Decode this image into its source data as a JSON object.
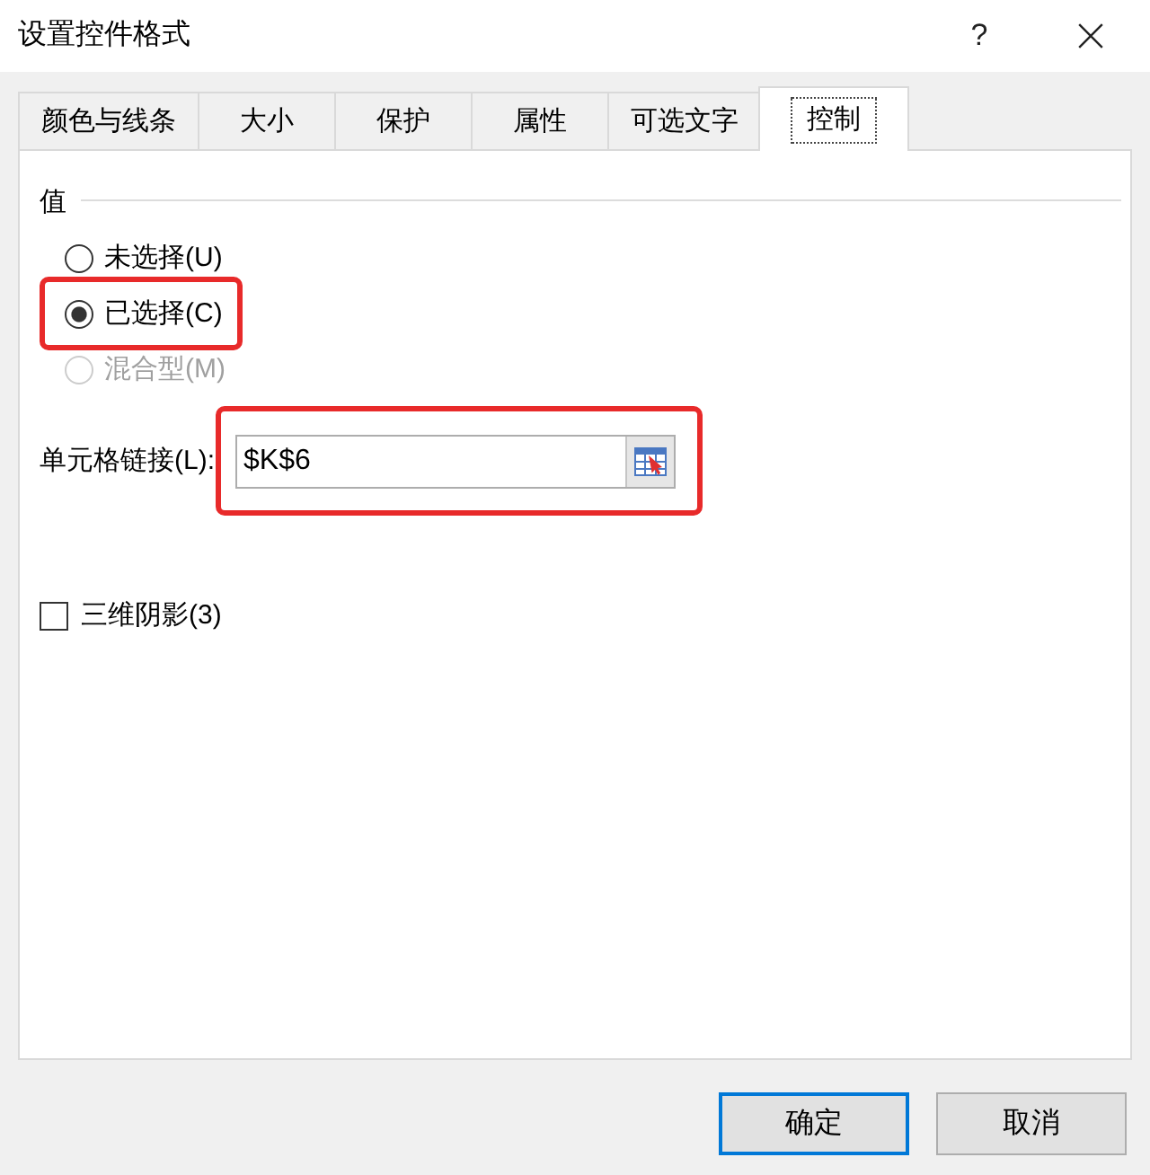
{
  "window": {
    "title": "设置控件格式",
    "help_button": "?"
  },
  "tabs": [
    {
      "label": "颜色与线条",
      "selected": false
    },
    {
      "label": "大小",
      "selected": false
    },
    {
      "label": "保护",
      "selected": false
    },
    {
      "label": "属性",
      "selected": false
    },
    {
      "label": "可选文字",
      "selected": false
    },
    {
      "label": "控制",
      "selected": true
    }
  ],
  "value_group": {
    "title": "值",
    "options": [
      {
        "label": "未选择(U)",
        "selected": false,
        "disabled": false,
        "highlighted": false
      },
      {
        "label": "已选择(C)",
        "selected": true,
        "disabled": false,
        "highlighted": true
      },
      {
        "label": "混合型(M)",
        "selected": false,
        "disabled": true,
        "highlighted": false
      }
    ]
  },
  "cell_link": {
    "label": "单元格链接(L):",
    "value": "$K$6",
    "highlighted": true
  },
  "checkbox": {
    "label": "三维阴影(3)",
    "checked": false
  },
  "buttons": [
    {
      "label": "确定",
      "default": true
    },
    {
      "label": "取消",
      "default": false
    }
  ]
}
